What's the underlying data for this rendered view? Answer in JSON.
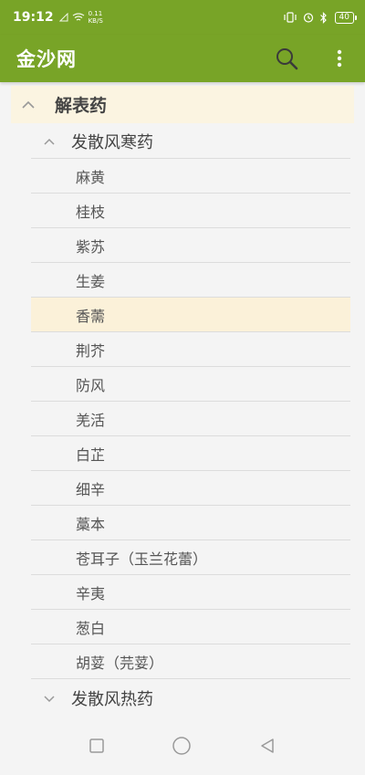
{
  "status": {
    "time": "19:12",
    "speed_top": "0.11",
    "speed_bottom": "KB/S",
    "battery": "40"
  },
  "app": {
    "title": "金沙网"
  },
  "tree": {
    "group": "解表药",
    "subgroup1": "发散风寒药",
    "items": [
      "麻黄",
      "桂枝",
      "紫苏",
      "生姜",
      "香薷",
      "荆芥",
      "防风",
      "羌活",
      "白芷",
      "细辛",
      "藁本",
      "苍耳子（玉兰花蕾）",
      "辛夷",
      "葱白",
      "胡荽（芫荽）"
    ],
    "selected_item": "香薷",
    "subgroup2": "发散风热药"
  },
  "colors": {
    "primary": "#78a427",
    "highlight": "#fbf1d9"
  }
}
